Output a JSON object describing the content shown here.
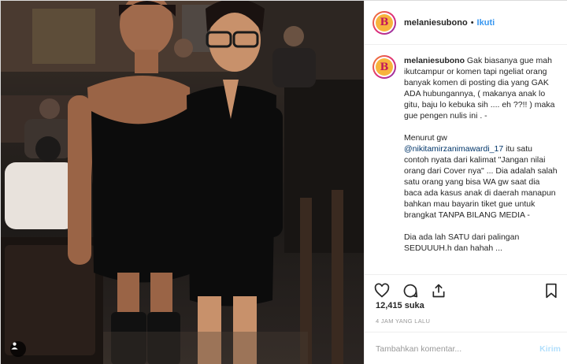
{
  "photo": {
    "background_colors": [
      "#3a2f28",
      "#1d1a18"
    ],
    "dress_color": "#0c0c0c",
    "glasses_color": "#1a1a1a"
  },
  "header": {
    "username": "melaniesubono",
    "separator": "•",
    "follow_label": "Ikuti"
  },
  "caption": {
    "username": "melaniesubono",
    "part1": " Gak biasanya gue mah ikutcampur or komen tapi ngeliat orang banyak komen di posting dia yang GAK ADA hubungannya, ( makanya anak lo gitu, baju lo kebuka sih .... eh ??!! ) maka gue pengen nulis ini . -\n\nMenurut gw\n",
    "mention": "@nikitamirzanimawardi_17",
    "part2": " itu satu contoh nyata dari kalimat \"Jangan nilai orang dari Cover nya\" ... Dia adalah salah satu orang yang bisa WA gw saat dia baca ada kasus anak di daerah manapun bahkan mau bayarin tiket gue untuk brangkat TANPA BILANG MEDIA -\n\nDia ada lah SATU dari palingan SEDUUUH.h dan hahah ..."
  },
  "actions": {
    "like_icon": "heart-icon",
    "comment_icon": "comment-icon",
    "share_icon": "share-icon",
    "save_icon": "bookmark-icon"
  },
  "likes": "12,415 suka",
  "timestamp": "4 JAM YANG LALU",
  "comment": {
    "placeholder": "Tambahkan komentar...",
    "post_label": "Kirim"
  },
  "colors": {
    "link": "#3897f0",
    "mention": "#003569",
    "muted": "#999999",
    "border": "#efefef"
  }
}
